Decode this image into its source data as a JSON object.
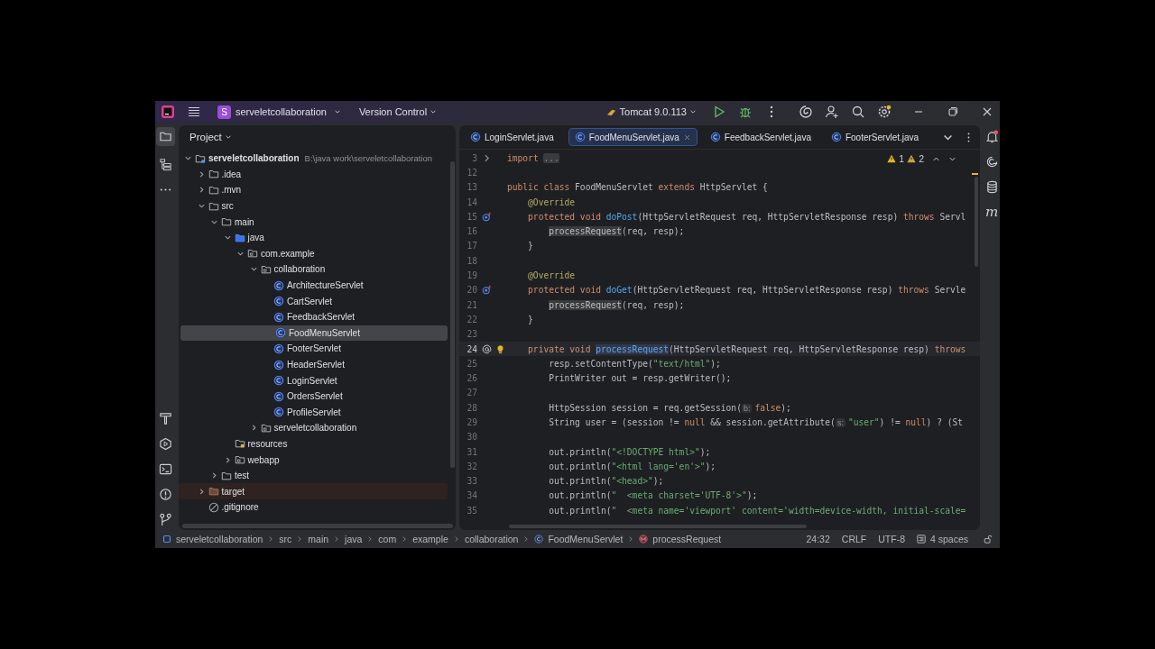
{
  "title_bar": {
    "project_badge": "S",
    "project": "serveletcollaboration",
    "vcs": "Version Control",
    "run_config": "Tomcat 9.0.113"
  },
  "project_panel": {
    "title": "Project",
    "tree": [
      {
        "label": "serveletcollaboration",
        "path": "B:\\java work\\serveletcollaboration",
        "kind": "module",
        "expanded": true,
        "selected": false,
        "children": [
          {
            "label": ".idea",
            "kind": "folder",
            "expanded": false,
            "selected": false
          },
          {
            "label": ".mvn",
            "kind": "folder",
            "expanded": false,
            "selected": false
          },
          {
            "label": "src",
            "kind": "folder",
            "expanded": true,
            "selected": false,
            "children": [
              {
                "label": "main",
                "kind": "folder",
                "expanded": true,
                "selected": false,
                "children": [
                  {
                    "label": "java",
                    "kind": "source",
                    "expanded": true,
                    "selected": false,
                    "children": [
                      {
                        "label": "com.example",
                        "kind": "package",
                        "expanded": true,
                        "selected": false,
                        "children": [
                          {
                            "label": "collaboration",
                            "kind": "package",
                            "expanded": true,
                            "selected": false,
                            "children": [
                              {
                                "label": "ArchitectureServlet",
                                "kind": "class",
                                "selected": false
                              },
                              {
                                "label": "CartServlet",
                                "kind": "class",
                                "selected": false
                              },
                              {
                                "label": "FeedbackServlet",
                                "kind": "class",
                                "selected": false
                              },
                              {
                                "label": "FoodMenuServlet",
                                "kind": "class",
                                "selected": true
                              },
                              {
                                "label": "FooterServlet",
                                "kind": "class",
                                "selected": false
                              },
                              {
                                "label": "HeaderServlet",
                                "kind": "class",
                                "selected": false
                              },
                              {
                                "label": "LoginServlet",
                                "kind": "class",
                                "selected": false
                              },
                              {
                                "label": "OrdersServlet",
                                "kind": "class",
                                "selected": false
                              },
                              {
                                "label": "ProfileServlet",
                                "kind": "class",
                                "selected": false
                              }
                            ]
                          },
                          {
                            "label": "serveletcollaboration",
                            "kind": "package",
                            "expanded": false,
                            "selected": false
                          }
                        ]
                      }
                    ]
                  },
                  {
                    "label": "resources",
                    "kind": "resources",
                    "selected": false
                  },
                  {
                    "label": "webapp",
                    "kind": "package",
                    "expanded": false,
                    "selected": false
                  }
                ]
              },
              {
                "label": "test",
                "kind": "folder",
                "expanded": false,
                "selected": false
              }
            ]
          },
          {
            "label": "target",
            "kind": "excluded",
            "expanded": false,
            "selected": false
          },
          {
            "label": ".gitignore",
            "kind": "ignore",
            "selected": false
          }
        ]
      }
    ]
  },
  "tabs": [
    {
      "label": "LoginServlet.java",
      "selected": false
    },
    {
      "label": "FoodMenuServlet.java",
      "selected": true
    },
    {
      "label": "FeedbackServlet.java",
      "selected": false
    },
    {
      "label": "FooterServlet.java",
      "selected": false
    }
  ],
  "inspections": {
    "warnings": "1",
    "weak_warnings": "2"
  },
  "right_toolbar": {
    "maven_label": "m"
  },
  "editor": {
    "lines": [
      {
        "number": "3",
        "kind": "top",
        "gutter": {
          "kind": "fold"
        },
        "tokens": [
          {
            "kind": "kw",
            "text": "import "
          },
          {
            "kind": "fold",
            "text": "..."
          }
        ]
      },
      {
        "number": "12"
      },
      {
        "number": "13",
        "kind": "top",
        "tokens": [
          {
            "kind": "kw",
            "text": "public class "
          },
          {
            "kind": "plain",
            "text": "FoodMenuServlet "
          },
          {
            "kind": "kw",
            "text": "extends "
          },
          {
            "kind": "plain",
            "text": "HttpServlet {"
          }
        ]
      },
      {
        "number": "14",
        "kind": "member",
        "tokens": [
          {
            "kind": "ann",
            "text": "@Override"
          }
        ]
      },
      {
        "number": "15",
        "kind": "member",
        "gutter": {
          "kind": "override"
        },
        "tokens": [
          {
            "kind": "kw",
            "text": "protected void "
          },
          {
            "kind": "fn",
            "text": "doPost"
          },
          {
            "kind": "plain",
            "text": "(HttpServletRequest req, HttpServletResponse resp) "
          },
          {
            "kind": "kw",
            "text": "throws "
          },
          {
            "kind": "plain",
            "text": "Servl"
          }
        ]
      },
      {
        "number": "16",
        "kind": "body",
        "tokens": [
          {
            "kind": "usage",
            "text": "processRequest"
          },
          {
            "kind": "plain",
            "text": "(req, resp);"
          }
        ]
      },
      {
        "number": "17",
        "kind": "member",
        "tokens": [
          {
            "kind": "plain",
            "text": "}"
          }
        ]
      },
      {
        "number": "18"
      },
      {
        "number": "19",
        "kind": "member",
        "tokens": [
          {
            "kind": "ann",
            "text": "@Override"
          }
        ]
      },
      {
        "number": "20",
        "kind": "member",
        "gutter": {
          "kind": "override"
        },
        "tokens": [
          {
            "kind": "kw",
            "text": "protected void "
          },
          {
            "kind": "fn",
            "text": "doGet"
          },
          {
            "kind": "plain",
            "text": "(HttpServletRequest req, HttpServletResponse resp) "
          },
          {
            "kind": "kw",
            "text": "throws "
          },
          {
            "kind": "plain",
            "text": "Servle"
          }
        ]
      },
      {
        "number": "21",
        "kind": "body",
        "tokens": [
          {
            "kind": "usage",
            "text": "processRequest"
          },
          {
            "kind": "plain",
            "text": "(req, resp);"
          }
        ]
      },
      {
        "number": "22",
        "kind": "member",
        "tokens": [
          {
            "kind": "plain",
            "text": "}"
          }
        ]
      },
      {
        "number": "23"
      },
      {
        "number": "24",
        "kind": "member",
        "gutter": {
          "kind": "implemented"
        },
        "current": true,
        "bulb": true,
        "tokens": [
          {
            "kind": "kw",
            "text": "private void "
          },
          {
            "kind": "decl",
            "text": "processRequest"
          },
          {
            "kind": "plain",
            "text": "(HttpServletRequest req, HttpServletResponse resp) "
          },
          {
            "kind": "kw",
            "text": "throws"
          }
        ]
      },
      {
        "number": "25",
        "kind": "body",
        "tokens": [
          {
            "kind": "plain",
            "text": "resp.setContentType("
          },
          {
            "kind": "str",
            "text": "\"text/html\""
          },
          {
            "kind": "plain",
            "text": ");"
          }
        ]
      },
      {
        "number": "26",
        "kind": "body",
        "tokens": [
          {
            "kind": "plain",
            "text": "PrintWriter out = resp.getWriter();"
          }
        ]
      },
      {
        "number": "27"
      },
      {
        "number": "28",
        "kind": "body",
        "tokens": [
          {
            "kind": "plain",
            "text": "HttpSession session = req.getSession("
          },
          {
            "kind": "hint",
            "text": "b:"
          },
          {
            "kind": "kw",
            "text": "false"
          },
          {
            "kind": "plain",
            "text": ");"
          }
        ]
      },
      {
        "number": "29",
        "kind": "body",
        "tokens": [
          {
            "kind": "plain",
            "text": "String user = (session != "
          },
          {
            "kind": "kw",
            "text": "null"
          },
          {
            "kind": "plain",
            "text": " && session.getAttribute("
          },
          {
            "kind": "hint",
            "text": "s:"
          },
          {
            "kind": "str",
            "text": "\"user\""
          },
          {
            "kind": "plain",
            "text": ") != "
          },
          {
            "kind": "kw",
            "text": "null"
          },
          {
            "kind": "plain",
            "text": ") ? (St"
          }
        ]
      },
      {
        "number": "30"
      },
      {
        "number": "31",
        "kind": "body",
        "tokens": [
          {
            "kind": "plain",
            "text": "out.println("
          },
          {
            "kind": "str",
            "text": "\"<!DOCTYPE html>\""
          },
          {
            "kind": "plain",
            "text": ");"
          }
        ]
      },
      {
        "number": "32",
        "kind": "body",
        "tokens": [
          {
            "kind": "plain",
            "text": "out.println("
          },
          {
            "kind": "str",
            "text": "\"<html lang='en'>\""
          },
          {
            "kind": "plain",
            "text": ");"
          }
        ]
      },
      {
        "number": "33",
        "kind": "body",
        "tokens": [
          {
            "kind": "plain",
            "text": "out.println("
          },
          {
            "kind": "str",
            "text": "\"<head>\""
          },
          {
            "kind": "plain",
            "text": ");"
          }
        ]
      },
      {
        "number": "34",
        "kind": "body",
        "tokens": [
          {
            "kind": "plain",
            "text": "out.println("
          },
          {
            "kind": "str",
            "text": "\"  <meta charset='UTF-8'>\""
          },
          {
            "kind": "plain",
            "text": ");"
          }
        ]
      },
      {
        "number": "35",
        "kind": "body",
        "tokens": [
          {
            "kind": "plain",
            "text": "out.println("
          },
          {
            "kind": "str",
            "text": "\"  <meta name='viewport' content='width=device-width, initial-scale="
          }
        ]
      }
    ]
  },
  "status_bar": {
    "breadcrumbs": [
      {
        "label": "serveletcollaboration",
        "kind": "module"
      },
      {
        "label": "src",
        "kind": "folder"
      },
      {
        "label": "main",
        "kind": "folder"
      },
      {
        "label": "java",
        "kind": "folder"
      },
      {
        "label": "com",
        "kind": "folder"
      },
      {
        "label": "example",
        "kind": "folder"
      },
      {
        "label": "collaboration",
        "kind": "folder"
      },
      {
        "label": "FoodMenuServlet",
        "kind": "class"
      },
      {
        "label": "processRequest",
        "kind": "method"
      }
    ],
    "position": "24:32",
    "line_separator": "CRLF",
    "encoding": "UTF-8",
    "indent": "4 spaces"
  }
}
